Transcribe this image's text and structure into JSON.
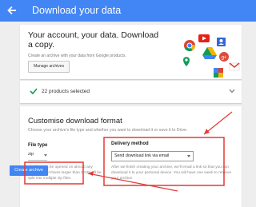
{
  "header": {
    "title": "Download your data",
    "bg_color": "#4285f4",
    "back_icon": "back-arrow-icon"
  },
  "intro": {
    "headline": "Your account, your data. Download a copy.",
    "subtitle": "Create an archive with your data from Google products.",
    "manage_label": "Manage archives"
  },
  "products": {
    "count_label": "22 products selected",
    "check_icon": "check-icon",
    "expand_icon": "chevron-down-icon"
  },
  "format": {
    "title": "Customise download format",
    "subtitle": "Choose your archive's file type and whether you want to download it or save it to Drive.",
    "file_type": {
      "label": "File type",
      "value": "zip",
      "help": "Zip files can be opened on almost any computer. Archives larger than 2 GB will be split into multiple zip files."
    },
    "delivery": {
      "label": "Delivery method",
      "value": "Send download link via email",
      "help": "After we finish creating your archive, we'll email a link so that you can download it to your personal device. You will have one week to retrieve your archive."
    }
  },
  "create_label": "Create archive",
  "annotation_color": "#e53935"
}
